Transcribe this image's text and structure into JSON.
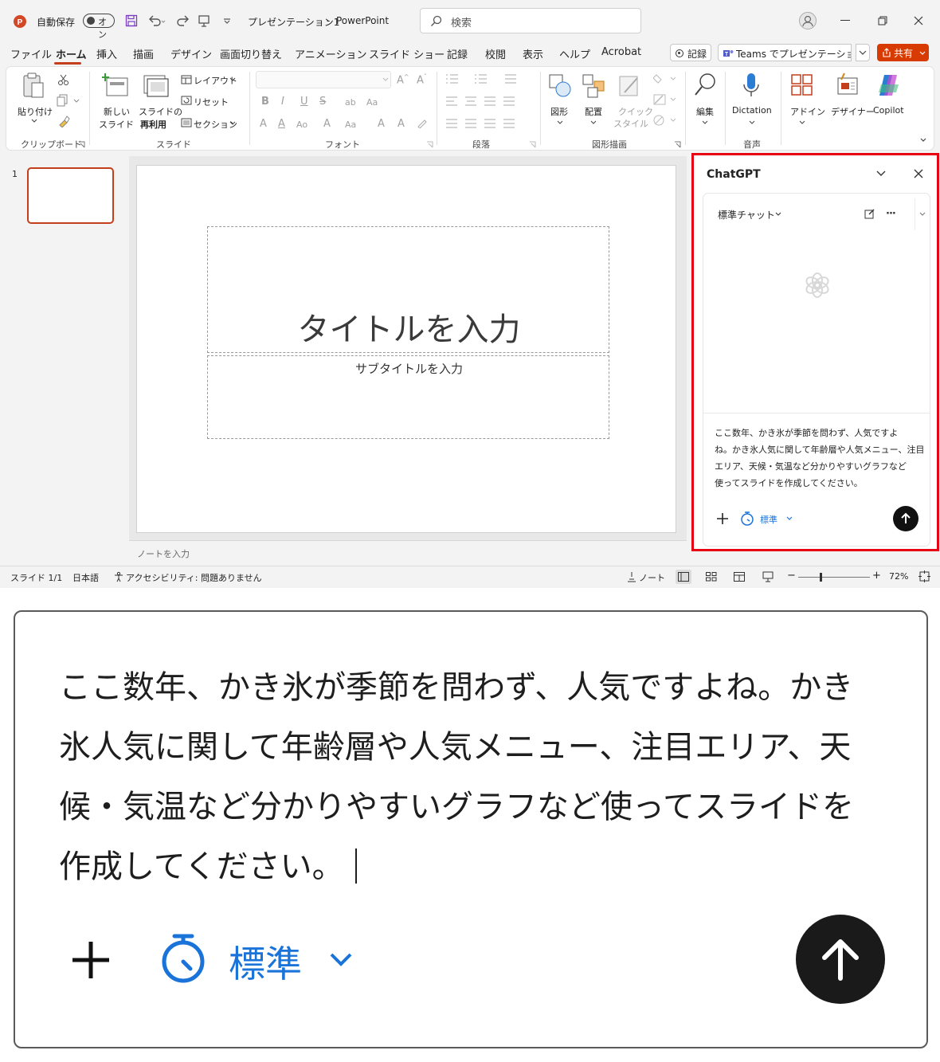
{
  "titlebar": {
    "autosave_label": "自動保存",
    "autosave_state": "オン",
    "doc_title": "プレゼンテーション1",
    "separator": "-",
    "app_name": "PowerPoint",
    "search_placeholder": "検索"
  },
  "tabs": [
    "ファイル",
    "ホーム",
    "挿入",
    "描画",
    "デザイン",
    "画面切り替え",
    "アニメーション",
    "スライド ショー",
    "記録",
    "校閲",
    "表示",
    "ヘルプ",
    "Acrobat"
  ],
  "tabbar_right": {
    "record": "記録",
    "teams": "Teams でプレゼンテーション",
    "share": "共有"
  },
  "ribbon": {
    "clipboard": {
      "paste": "貼り付け",
      "label": "クリップボード"
    },
    "slides": {
      "new_slide_1": "新しい",
      "new_slide_2": "スライド",
      "reuse_1": "スライドの",
      "reuse_2": "再利用",
      "layout": "レイアウト",
      "reset": "リセット",
      "section": "セクション",
      "label": "スライド"
    },
    "font": {
      "label": "フォント"
    },
    "paragraph": {
      "label": "段落"
    },
    "drawing": {
      "shapes": "図形",
      "arrange": "配置",
      "quick_1": "クイック",
      "quick_2": "スタイル",
      "label": "図形描画"
    },
    "edit": {
      "label": "編集"
    },
    "voice": {
      "dictation": "Dictation",
      "label": "音声"
    },
    "addins": {
      "label": "アドイン"
    },
    "designer": {
      "label": "デザイナー"
    },
    "copilot": {
      "label": "Copilot"
    }
  },
  "thumbs": {
    "slide_number": "1"
  },
  "slide": {
    "title_placeholder": "タイトルを入力",
    "subtitle_placeholder": "サブタイトルを入力"
  },
  "notes_placeholder": "ノートを入力",
  "gpt": {
    "header": "ChatGPT",
    "mode": "標準チャット",
    "prompt_small_lines": [
      "ここ数年、かき氷が季節を問わず、人気ですよ",
      "ね。かき氷人気に関して年齢層や人気メニュー、注目",
      "エリア、天候・気温など分かりやすいグラフなど",
      "使ってスライドを作成してください。"
    ],
    "model": "標準"
  },
  "status": {
    "slide": "スライド 1/1",
    "language": "日本語",
    "accessibility": "アクセシビリティ: 問題ありません",
    "notes": "ノート",
    "zoom": "72%"
  },
  "zoom": {
    "prompt_lines": [
      "ここ数年、かき氷が季節を問わず、人気ですよね。かき",
      "氷人気に関して年齢層や人気メニュー、注目エリア、天",
      "候・気温など分かりやすいグラフなど使ってスライドを",
      "作成してください。"
    ],
    "model": "標準"
  },
  "colors": {
    "accent_red": "#e60012",
    "share_orange": "#d83b01",
    "link_blue": "#1a73d9"
  }
}
